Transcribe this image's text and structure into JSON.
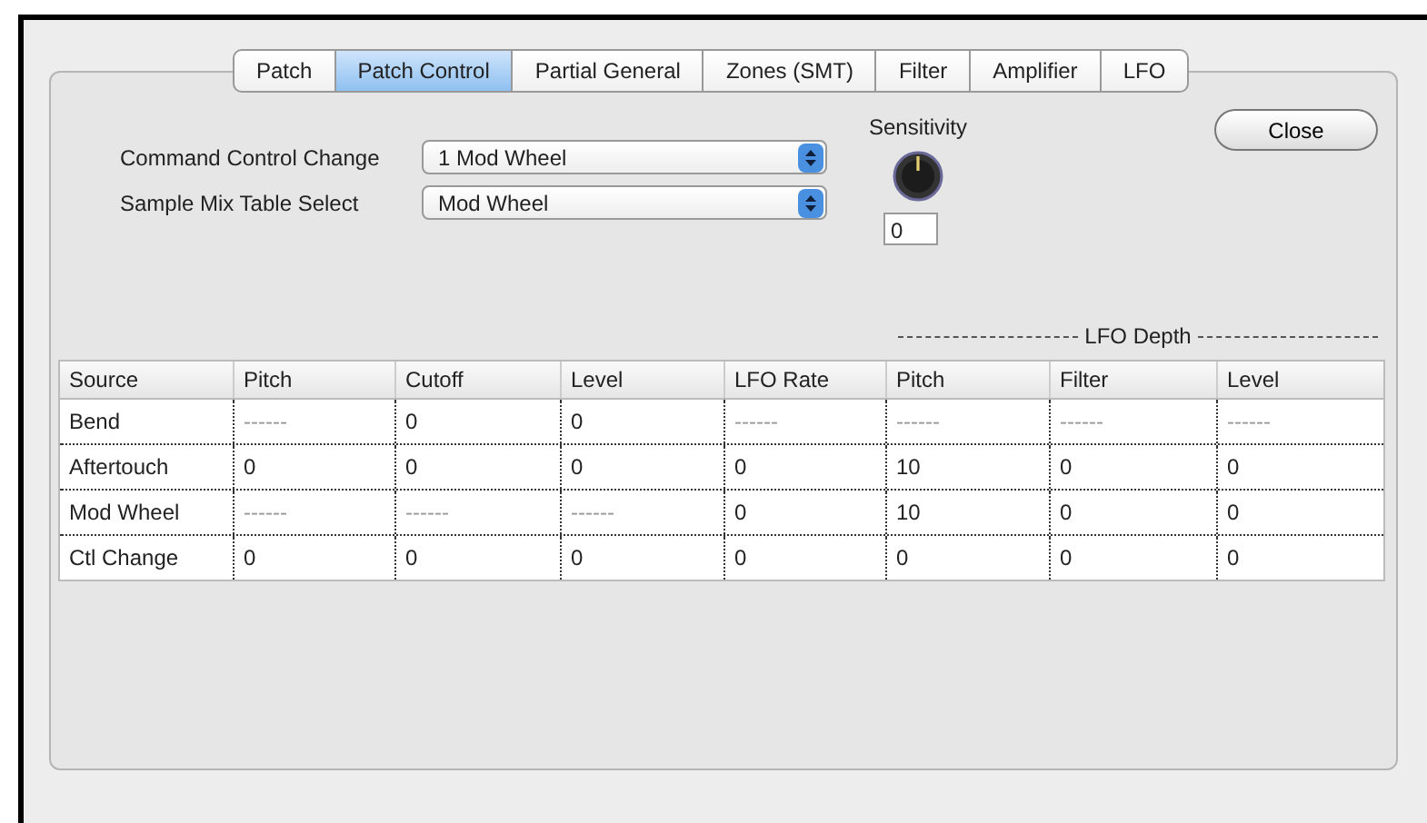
{
  "tabs": [
    {
      "label": "Patch",
      "selected": false
    },
    {
      "label": "Patch Control",
      "selected": true
    },
    {
      "label": "Partial General",
      "selected": false
    },
    {
      "label": "Zones (SMT)",
      "selected": false
    },
    {
      "label": "Filter",
      "selected": false
    },
    {
      "label": "Amplifier",
      "selected": false
    },
    {
      "label": "LFO",
      "selected": false
    }
  ],
  "settings": [
    {
      "label": "Command Control Change",
      "value": "1 Mod Wheel"
    },
    {
      "label": "Sample Mix Table Select",
      "value": "Mod Wheel"
    }
  ],
  "sensitivity": {
    "label": "Sensitivity",
    "value": "0"
  },
  "close_button": "Close",
  "group_label": "LFO Depth",
  "table": {
    "columns": [
      "Source",
      "Pitch",
      "Cutoff",
      "Level",
      "LFO Rate",
      "Pitch",
      "Filter",
      "Level"
    ],
    "rows": [
      [
        "Bend",
        "------",
        "0",
        "0",
        "------",
        "------",
        "------",
        "------"
      ],
      [
        "Aftertouch",
        "0",
        "0",
        "0",
        "0",
        "10",
        "0",
        "0"
      ],
      [
        "Mod Wheel",
        "------",
        "------",
        "------",
        "0",
        "10",
        "0",
        "0"
      ],
      [
        "Ctl Change",
        "0",
        "0",
        "0",
        "0",
        "0",
        "0",
        "0"
      ]
    ]
  }
}
